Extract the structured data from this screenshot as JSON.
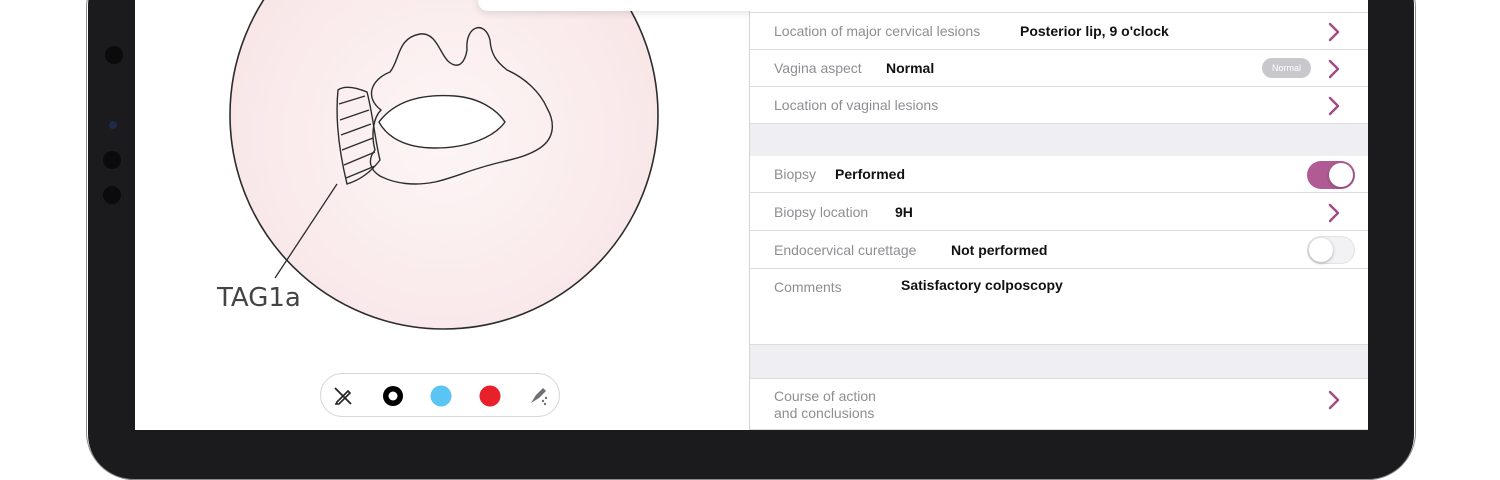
{
  "colors": {
    "accent": "#a14a85",
    "toggle_on": "#b05b93",
    "sketch_fill": "#fbeff0",
    "pen_black": "#000000",
    "pen_blue": "#5ac4f5",
    "pen_red": "#e8202a",
    "separator": "#efeff3"
  },
  "drawing": {
    "annotation_label": "TAG1a"
  },
  "toolbar": {
    "tools": [
      {
        "icon": "pencil-off-icon"
      },
      {
        "icon": "black-pen-icon"
      },
      {
        "icon": "blue-pen-icon"
      },
      {
        "icon": "red-pen-icon"
      },
      {
        "icon": "eraser-icon"
      }
    ]
  },
  "form": {
    "section1": [
      {
        "label": "Location of major cervical lesions",
        "value": "Posterior lip, 9 o'clock"
      },
      {
        "label": "Vagina aspect",
        "value": "Normal",
        "badge": "Normal"
      },
      {
        "label": "Location of vaginal lesions",
        "value": ""
      }
    ],
    "section2": {
      "biopsy": {
        "label": "Biopsy",
        "value": "Performed",
        "toggle_on": true
      },
      "biopsy_location": {
        "label": "Biopsy location",
        "value": "9H"
      },
      "endocervical": {
        "label": "Endocervical curettage",
        "value": "Not performed",
        "toggle_on": false
      },
      "comments": {
        "label": "Comments",
        "value": "Satisfactory colposcopy"
      }
    },
    "section3": {
      "course_line1": "Course of action",
      "course_line2": "and conclusions"
    }
  }
}
